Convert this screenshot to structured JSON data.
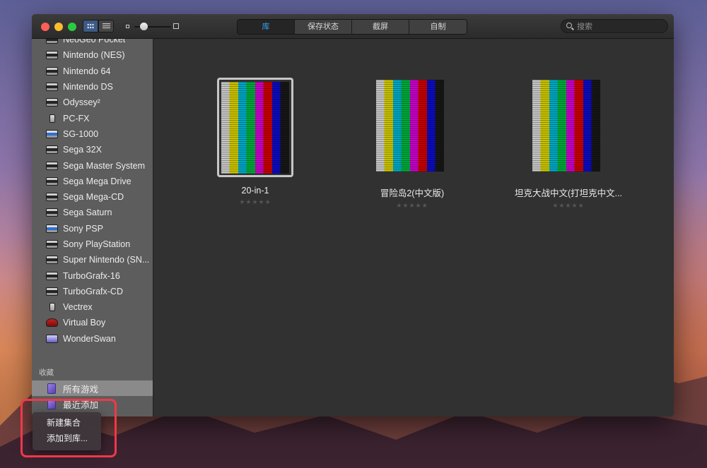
{
  "toolbar": {
    "tabs": [
      "库",
      "保存状态",
      "截屏",
      "自制"
    ],
    "active_tab": "库",
    "search_placeholder": "搜索"
  },
  "sidebar": {
    "consoles": [
      "NeoGeo Pocket",
      "Nintendo (NES)",
      "Nintendo 64",
      "Nintendo DS",
      "Odyssey²",
      "PC-FX",
      "SG-1000",
      "Sega 32X",
      "Sega Master System",
      "Sega Mega Drive",
      "Sega Mega-CD",
      "Sega Saturn",
      "Sony PSP",
      "Sony PlayStation",
      "Super Nintendo (SN...",
      "TurboGrafx-16",
      "TurboGrafx-CD",
      "Vectrex",
      "Virtual Boy",
      "WonderSwan"
    ],
    "collections_heading": "收藏",
    "collections": [
      "所有游戏",
      "最近添加"
    ]
  },
  "games": [
    {
      "title": "20-in-1",
      "rating": "★★★★★"
    },
    {
      "title": "冒险岛2(中文版)",
      "rating": "★★★★★"
    },
    {
      "title": "坦克大战中文(打坦克中文...",
      "rating": "★★★★★"
    }
  ],
  "menu": {
    "items": [
      "新建集合",
      "添加到库..."
    ]
  },
  "colors": {
    "accent": "#33a4f7",
    "highlight": "#f0384a"
  }
}
